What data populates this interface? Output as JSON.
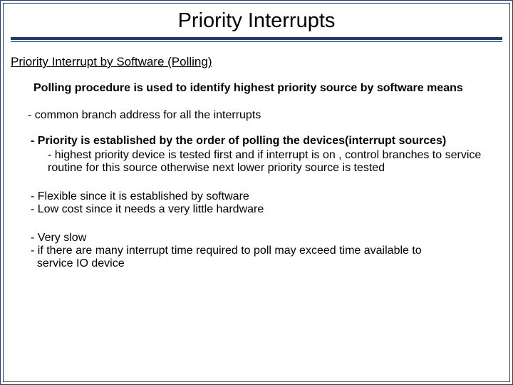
{
  "title": "Priority Interrupts",
  "subhead": "Priority Interrupt by Software (Polling)",
  "intro": "Polling procedure is used to identify highest priority source by software means",
  "b1": "-  common branch address for all the interrupts",
  "b2": "- Priority is established by the order of polling the devices(interrupt sources)",
  "b2_sub": "-  highest priority device is tested first and if interrupt is on , control branches to service routine for this source otherwise next lower priority source is tested",
  "adv1": "- Flexible since it is established by software",
  "adv2": "- Low cost since it needs a very little hardware",
  "dis1": "- Very slow",
  "dis2": "- if there are many interrupt time required to poll may exceed time available to",
  "dis2b": "  service IO device"
}
